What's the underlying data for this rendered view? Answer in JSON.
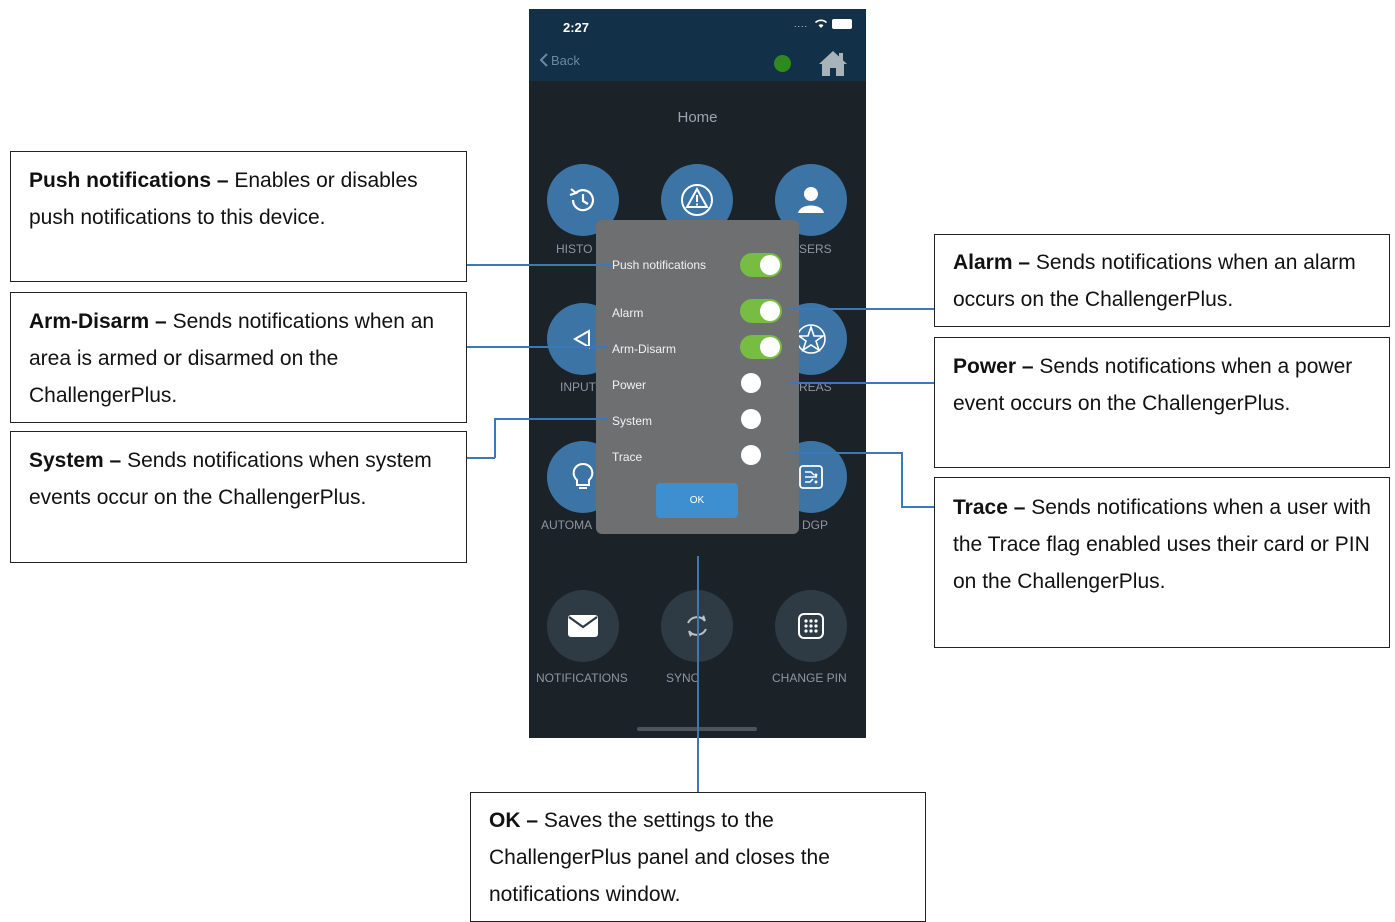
{
  "phone": {
    "status": {
      "time": "2:27",
      "signal_dots": "....",
      "icons": [
        "wifi-icon",
        "battery-icon"
      ]
    },
    "nav": {
      "back_label": "Back",
      "icons": [
        "chevron-left-icon",
        "status-dot",
        "home-icon"
      ]
    },
    "page_title": "Home",
    "tiles": [
      {
        "label": "HISTO",
        "icon": "history-icon"
      },
      {
        "label": "",
        "icon": "alert-icon"
      },
      {
        "label": "SERS",
        "icon": "user-icon"
      },
      {
        "label": "INPUT",
        "icon": "input-icon"
      },
      {
        "label": "REAS",
        "icon": "areas-icon"
      },
      {
        "label": "AUTOMA",
        "icon": "bulb-icon"
      },
      {
        "label": "DGP",
        "icon": "circuit-icon"
      },
      {
        "label": "NOTIFICATIONS",
        "icon": "mail-icon"
      },
      {
        "label": "SYNC",
        "icon": "sync-icon"
      },
      {
        "label": "CHANGE PIN",
        "icon": "keypad-icon"
      }
    ]
  },
  "modal": {
    "rows": [
      {
        "label": "Push notifications",
        "on": true
      },
      {
        "label": "Alarm",
        "on": true
      },
      {
        "label": "Arm-Disarm",
        "on": true
      },
      {
        "label": "Power",
        "on": false
      },
      {
        "label": "System",
        "on": false
      },
      {
        "label": "Trace",
        "on": false
      }
    ],
    "ok_label": "OK"
  },
  "callouts": {
    "push": {
      "term": "Push notifications –",
      "desc": " Enables or disables push notifications to this device."
    },
    "arm": {
      "term": "Arm-Disarm –",
      "desc": " Sends notifications when an area is armed or disarmed on the ChallengerPlus."
    },
    "system": {
      "term": "System –",
      "desc": " Sends notifications when system events occur on the ChallengerPlus."
    },
    "alarm": {
      "term": "Alarm –",
      "desc": " Sends notifications when an alarm occurs on the ChallengerPlus."
    },
    "power": {
      "term": "Power –",
      "desc": " Sends notifications when a power event occurs on the ChallengerPlus."
    },
    "trace": {
      "term": "Trace –",
      "desc": " Sends notifications when a user with the Trace flag enabled uses their card or PIN on the ChallengerPlus."
    },
    "ok": {
      "term": "OK –",
      "desc": " Saves the settings to the ChallengerPlus panel and closes the notifications window."
    }
  },
  "colors": {
    "toggle_on": "#76bd42",
    "accent_blue": "#3d74a6",
    "ok_button": "#3d8fd0",
    "status_green": "#2f8a1e",
    "leader_line": "#3c77b8"
  }
}
